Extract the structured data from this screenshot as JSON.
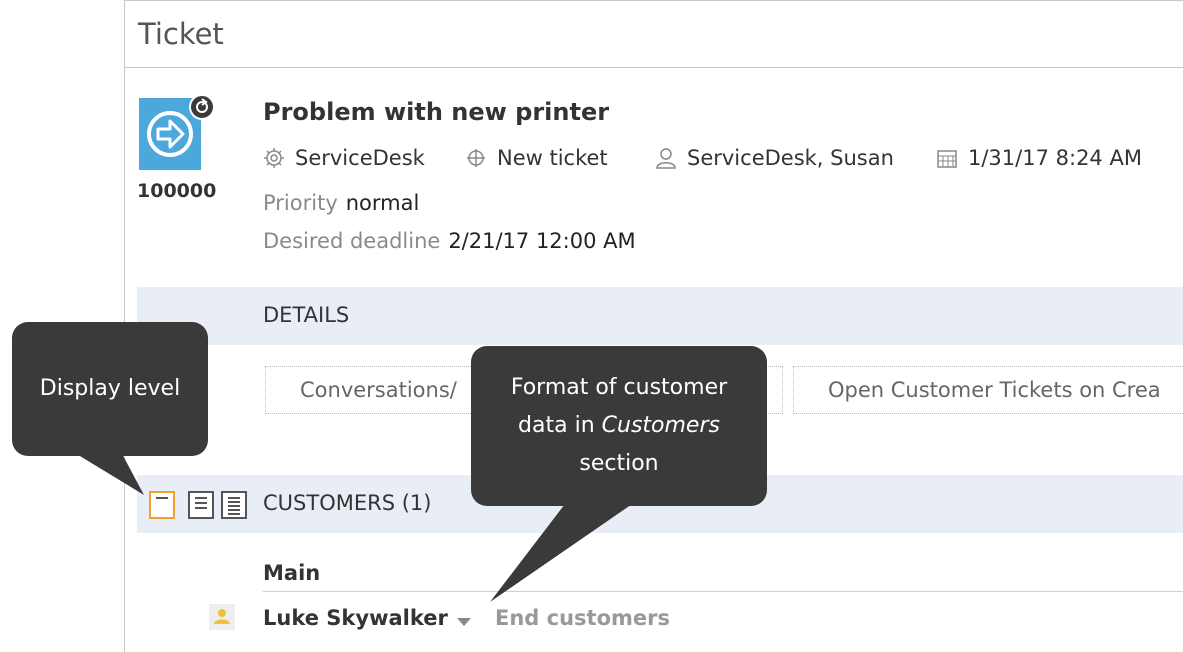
{
  "window": {
    "title": "Ticket"
  },
  "ticket": {
    "number": "100000",
    "title": "Problem with new printer",
    "queue": "ServiceDesk",
    "state": "New ticket",
    "owner": "ServiceDesk, Susan",
    "created": "1/31/17 8:24 AM",
    "priority_label": "Priority",
    "priority_value": "normal",
    "deadline_label": "Desired deadline",
    "deadline_value": "2/21/17 12:00 AM"
  },
  "details": {
    "section_label": "DETAILS",
    "tabs": [
      {
        "label": "Conversations/"
      },
      {
        "label": "Open Customer Tickets on Crea"
      }
    ]
  },
  "customers": {
    "section_label": "CUSTOMERS (1)",
    "group_label": "Main",
    "items": [
      {
        "name": "Luke Skywalker",
        "type": "End customers"
      }
    ]
  },
  "callouts": {
    "display_level": "Display level",
    "format_line1": "Format of customer",
    "format_line2_prefix": "data in ",
    "format_line2_emph": "Customers",
    "format_line3": "section"
  },
  "colors": {
    "ticket_icon": "#4ca7dd",
    "section_bar": "#e9eef6",
    "callout_bg": "#3a3a3a",
    "active_level": "#f0a030"
  },
  "icons": {
    "queue": "gear-icon",
    "state": "crosshair-icon",
    "owner": "person-icon",
    "created": "calendar-icon"
  }
}
